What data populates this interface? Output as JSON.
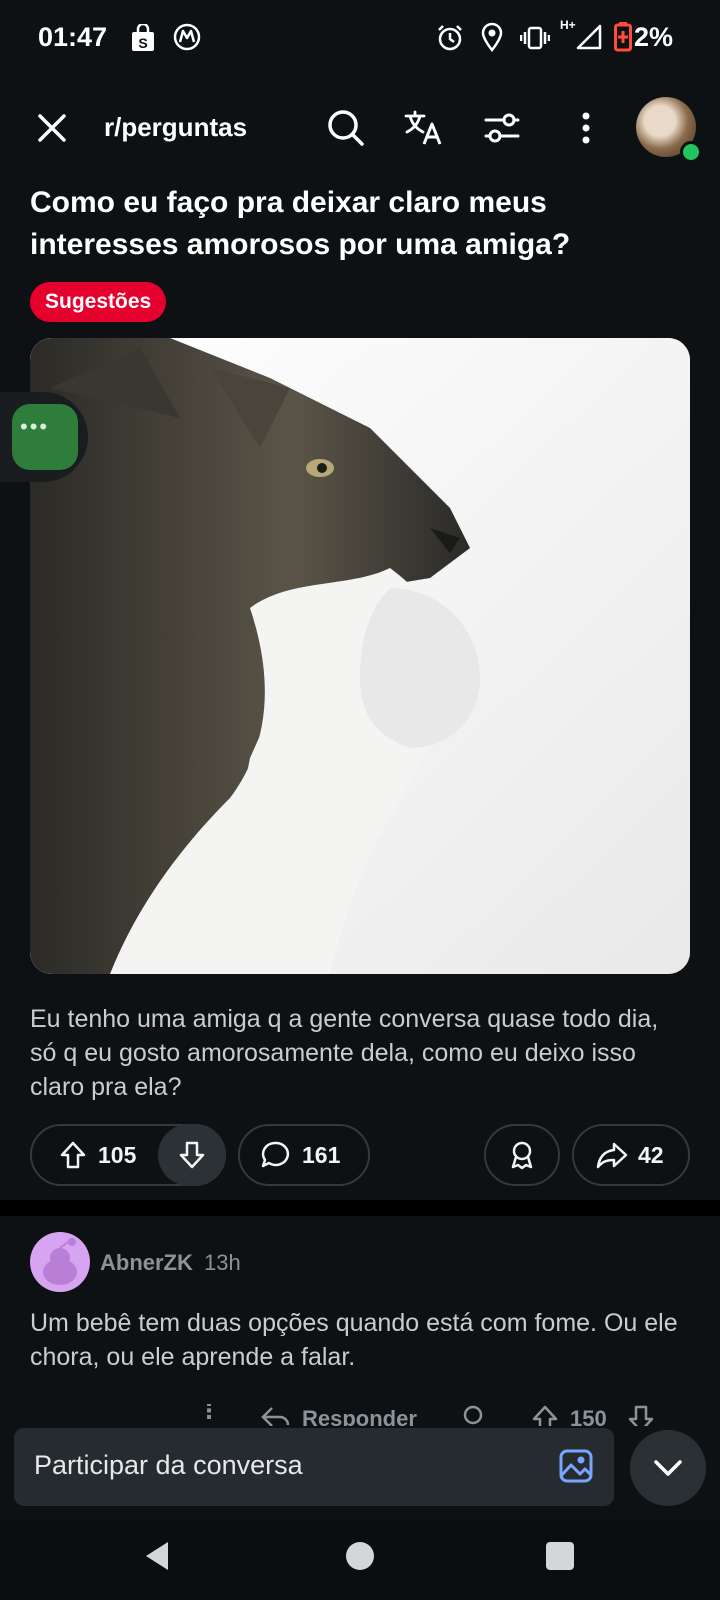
{
  "status_bar": {
    "time": "01:47",
    "network": "H+",
    "battery_pct": "2%",
    "icons": [
      "shopping-bag-icon",
      "motorola-icon",
      "alarm-icon",
      "location-icon",
      "vibrate-icon",
      "signal-icon",
      "battery-icon"
    ]
  },
  "header": {
    "subreddit": "r/perguntas",
    "icons": [
      "close-icon",
      "search-icon",
      "translate-icon",
      "filter-icon",
      "more-icon",
      "avatar"
    ]
  },
  "post": {
    "title": "Como eu faço pra deixar claro meus interesses amorosos por uma amiga?",
    "flair": "Sugestões",
    "flair_color": "#e6002e",
    "body": "Eu tenho uma amiga q a gente conversa quase todo dia, só q eu gosto amorosamente dela, como eu deixo isso claro pra ela?",
    "upvotes": "105",
    "comments": "161",
    "shares": "42"
  },
  "comment": {
    "author": "AbnerZK",
    "time": "13h",
    "text": "Um bebê tem duas opções quando está com fome. Ou ele chora, ou ele aprende a falar.",
    "reply_label": "Responder",
    "votes": "150"
  },
  "composer": {
    "placeholder": "Participar da conversa"
  },
  "colors": {
    "background": "#0e1113",
    "online": "#22c55e",
    "flair": "#e6002e"
  }
}
